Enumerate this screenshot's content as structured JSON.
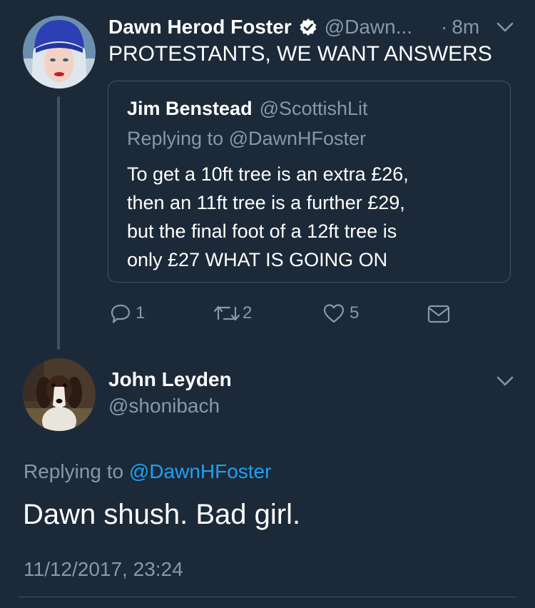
{
  "tweet": {
    "author_name": "Dawn Herod Foster",
    "author_handle": "@Dawn...",
    "time": "8m",
    "text": "PROTESTANTS, WE WANT ANSWERS",
    "avatar_icon": "user-avatar-blue-hat",
    "quote": {
      "author_name": "Jim Benstead",
      "author_handle": "@ScottishLit",
      "replying_label": "Replying to",
      "replying_handle": "@DawnHFoster",
      "lines": [
        "To get a 10ft tree is an extra £26,",
        "then an 11ft tree is a further £29,",
        "but the final foot of a 12ft tree is",
        "only £27 WHAT IS GOING ON"
      ]
    },
    "actions": {
      "reply_count": "1",
      "retweet_count": "2",
      "like_count": "5"
    }
  },
  "reply": {
    "author_name": "John Leyden",
    "author_handle": "@shonibach",
    "avatar_icon": "dog-avatar",
    "replying_label": "Replying to",
    "replying_handle": "@DawnHFoster",
    "text": "Dawn shush. Bad girl.",
    "timestamp": "11/12/2017, 23:24"
  },
  "colors": {
    "background": "#1c2938",
    "muted_text": "#8899a6",
    "link": "#1da1f2",
    "border": "#3d5466"
  }
}
